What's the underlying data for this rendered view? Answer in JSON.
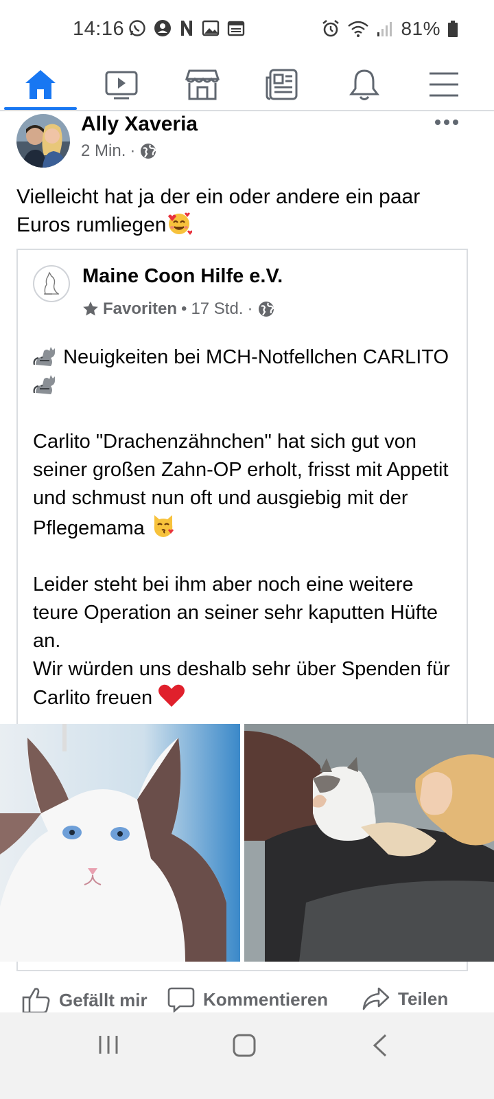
{
  "status_bar": {
    "time": "14:16",
    "battery": "81%",
    "left_icons": [
      "whatsapp-icon",
      "account-icon",
      "n-icon",
      "gallery-icon",
      "calendar-icon"
    ],
    "right_icons": [
      "alarm-icon",
      "wifi-icon",
      "signal-icon",
      "battery-icon"
    ]
  },
  "top_nav": {
    "items": [
      "home-icon",
      "watch-icon",
      "marketplace-icon",
      "news-icon",
      "notifications-icon",
      "menu-icon"
    ],
    "active": "home-icon",
    "accent": "#1877f2"
  },
  "post": {
    "author": "Ally Xaveria",
    "time": "2 Min.",
    "separator": "·",
    "text": "Vielleicht hat ja der ein oder andere ein paar Euros rumliegen",
    "text_emoji": "smiling-face-with-hearts"
  },
  "shared_post": {
    "page_name": "Maine Coon Hilfe e.V.",
    "favorites_label": "Favoriten",
    "time": "17 Std.",
    "separator": "·",
    "headline": "Neuigkeiten bei MCH-Notfellchen CARLITO",
    "paragraph1": "Carlito \"Drachenzähnchen\" hat sich gut von seiner großen Zahn-OP erholt, frisst mit Appetit und schmust nun oft und ausgiebig mit der Pflegemama",
    "paragraph2_line1": "Leider steht bei ihm aber noch eine weitere teure Operation an seiner sehr kaputten Hüfte an.",
    "paragraph2_line2": "Wir würden uns deshalb sehr über Spenden für Carlito freuen",
    "photos": [
      "white-maine-coon-cat-photo",
      "woman-cuddling-cat-photo"
    ]
  },
  "actions": {
    "like": "Gefällt mir",
    "comment": "Kommentieren",
    "share": "Teilen"
  },
  "system_nav": [
    "recent-apps-icon",
    "home-button-icon",
    "back-icon"
  ]
}
